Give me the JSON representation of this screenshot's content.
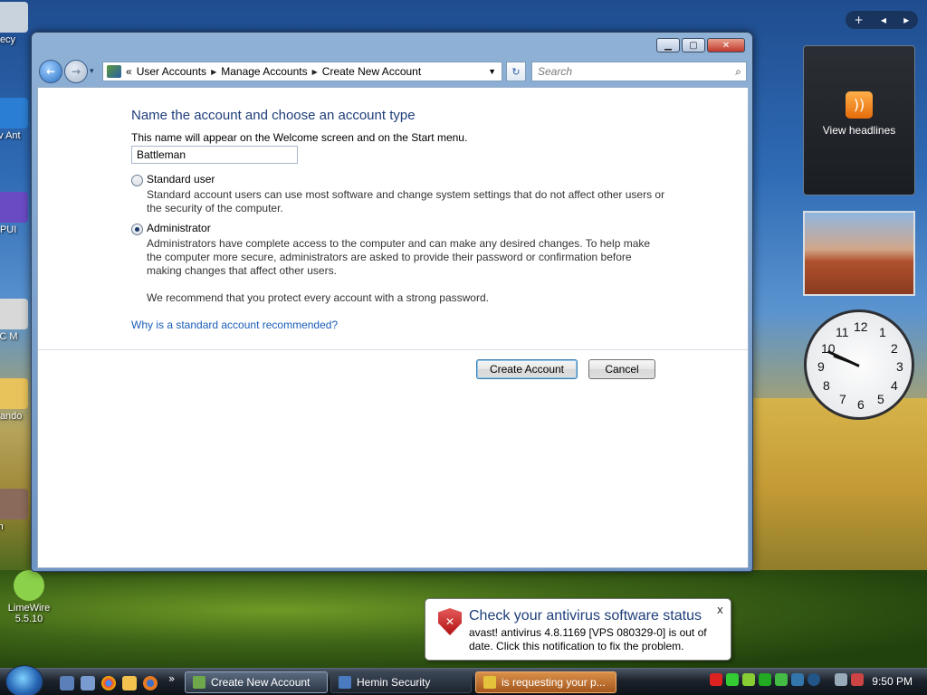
{
  "window": {
    "breadcrumb": [
      "User Accounts",
      "Manage Accounts",
      "Create New Account"
    ],
    "breadcrumb_prefix": "«",
    "search_placeholder": "Search"
  },
  "form": {
    "title": "Name the account and choose an account type",
    "description": "This name will appear on the Welcome screen and on the Start menu.",
    "account_name": "Battleman",
    "standard": {
      "label": "Standard user",
      "text": "Standard account users can use most software and change system settings that do not affect other users or the security of the computer.",
      "selected": false
    },
    "administrator": {
      "label": "Administrator",
      "text": "Administrators have complete access to the computer and can make any desired changes. To help make the computer more secure, administrators are asked to provide their password or confirmation before making changes that affect other users.",
      "selected": true
    },
    "recommendation": "We recommend that you protect every account with a strong password.",
    "help_link": "Why is a standard account recommended?",
    "create_button": "Create Account",
    "cancel_button": "Cancel"
  },
  "desktop": {
    "icons": [
      {
        "label": "Recy",
        "color": "#c9d3de"
      },
      {
        "label": "av Ant",
        "color": "#2a7fd4"
      },
      {
        "label": "CPUI",
        "color": "#6a4bc4"
      },
      {
        "label": "PC M",
        "color": "#d8d8d8"
      },
      {
        "label": "Rando",
        "color": "#e8c25a"
      },
      {
        "label": "im",
        "color": "#8a6a5a"
      },
      {
        "label": "LimeWire 5.5.10",
        "color": "#8bd14a"
      }
    ]
  },
  "gadgets": {
    "rss_label": "View headlines",
    "clock_numbers": [
      "12",
      "1",
      "2",
      "3",
      "4",
      "5",
      "6",
      "7",
      "8",
      "9",
      "10",
      "11"
    ]
  },
  "notification": {
    "title": "Check your antivirus software status",
    "message": "avast! antivirus 4.8.1169 [VPS 080329-0] is out of date. Click this notification to fix the problem.",
    "close": "x"
  },
  "taskbar": {
    "tasks": [
      {
        "label": "Create New Account",
        "state": "active"
      },
      {
        "label": "Hemin Security",
        "state": "normal"
      },
      {
        "label": "is requesting your p...",
        "state": "flash"
      }
    ],
    "time": "9:50 PM",
    "overflow": "»"
  }
}
